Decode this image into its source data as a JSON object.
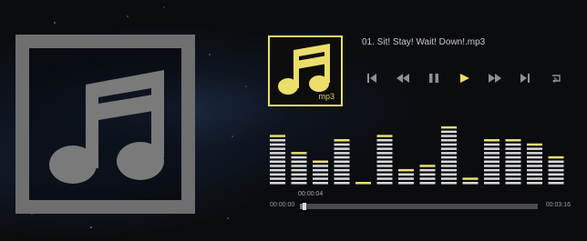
{
  "player": {
    "track_title": "01. Sit! Stay! Wait! Down!.mp3",
    "file_ext": "mp3",
    "current_time": "00:00:04",
    "time_start": "00:00:00",
    "time_end": "00:03:16",
    "progress": 0.021
  },
  "controls": [
    {
      "name": "skip-to-start-icon"
    },
    {
      "name": "rewind-icon"
    },
    {
      "name": "pause-icon"
    },
    {
      "name": "play-icon"
    },
    {
      "name": "fast-forward-icon"
    },
    {
      "name": "skip-to-end-icon"
    },
    {
      "name": "repeat-icon"
    }
  ],
  "equalizer": {
    "levels": [
      11,
      7,
      5,
      10,
      0,
      11,
      3,
      4,
      13,
      1,
      10,
      10,
      9,
      6
    ],
    "max_segments": 13
  },
  "colors": {
    "accent_yellow": "#ecde6a",
    "frame_gray": "#6f6f6f",
    "eq_white": "#d8d8d8",
    "eq_peak": "#eadf73"
  }
}
